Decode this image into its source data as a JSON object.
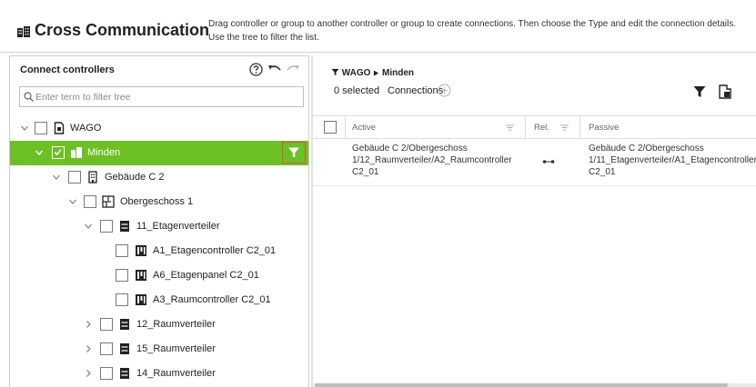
{
  "header": {
    "title": "Cross Communication",
    "description": "Drag controller or group to another controller or group to create connections. Then choose the Type and edit the connection details. Use the tree to filter the list."
  },
  "left_panel": {
    "title": "Connect controllers",
    "search": {
      "placeholder": "Enter term to filter tree",
      "value": ""
    },
    "tree": [
      {
        "label": "WAGO",
        "icon": "document-icon",
        "expanded": true,
        "checked": false
      },
      {
        "label": "Minden",
        "icon": "city-icon",
        "expanded": true,
        "checked": true,
        "selected": true
      },
      {
        "label": "Gebäude C 2",
        "icon": "building-icon",
        "expanded": true,
        "checked": false
      },
      {
        "label": "Obergeschoss 1",
        "icon": "floor-plan-icon",
        "expanded": true,
        "checked": false
      },
      {
        "label": "11_Etagenverteiler",
        "icon": "distributor-icon",
        "expanded": true,
        "checked": false
      },
      {
        "label": "A1_Etagencontroller C2_01",
        "icon": "controller-icon",
        "checked": false
      },
      {
        "label": "A6_Etagenpanel C2_01",
        "icon": "controller-icon",
        "checked": false
      },
      {
        "label": "A3_Raumcontroller C2_01",
        "icon": "controller-icon",
        "checked": false
      },
      {
        "label": "12_Raumverteiler",
        "icon": "distributor-icon",
        "expanded": false,
        "checked": false
      },
      {
        "label": "15_Raumverteiler",
        "icon": "distributor-icon",
        "expanded": false,
        "checked": false
      },
      {
        "label": "14_Raumverteiler",
        "icon": "distributor-icon",
        "expanded": false,
        "checked": false
      }
    ]
  },
  "right_panel": {
    "breadcrumb": {
      "root": "WAGO",
      "current": "Minden"
    },
    "selected_count": "0 selected",
    "connections_label": "Connections",
    "table": {
      "headers": {
        "active": "Active",
        "rel": "Rel.",
        "passive": "Passive"
      },
      "rows": [
        {
          "active": "Gebäude C 2/Obergeschoss 1/12_Raumverteiler/A2_Raumcontroller C2_01",
          "rel": "connection-icon",
          "passive": "Gebäude C 2/Obergeschoss 1/11_Etagenverteiler/A1_Etagencontroller C2_01"
        }
      ]
    }
  },
  "colors": {
    "selected_row": "#6cc024",
    "filter_button_border": "#d9534f",
    "text": "#222222"
  }
}
